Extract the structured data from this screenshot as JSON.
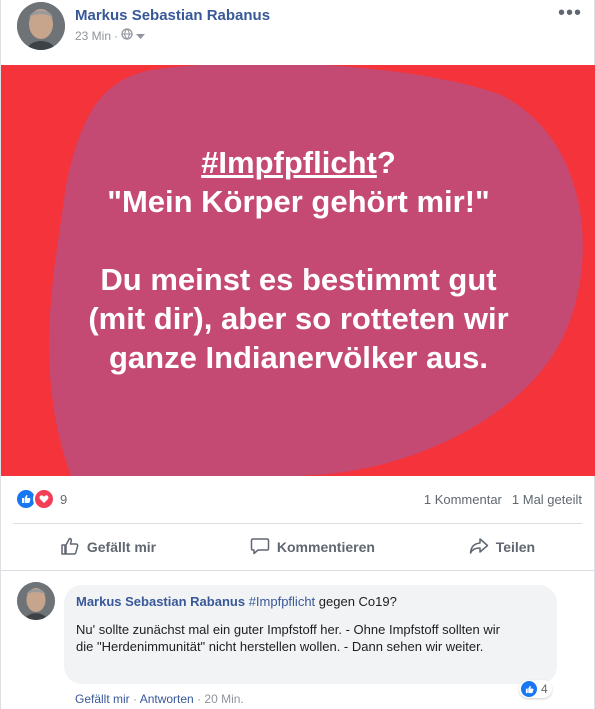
{
  "post": {
    "author": "Markus Sebastian Rabanus",
    "time": "23 Min",
    "separator": "·",
    "visibility_icon": "globe-icon",
    "more_label": "•••",
    "image": {
      "background": "#f4333a",
      "blob_color": "#c04c7a",
      "hashtag": "#Impfpflicht",
      "hashtag_suffix": "?",
      "line2": "\"Mein Körper gehört mir!\"",
      "line3": "Du meinst es bestimmt gut",
      "line4": "(mit dir), aber so rotteten wir",
      "line5": "ganze Indianervölker aus."
    },
    "reactions": {
      "count": "9",
      "types": [
        "like-icon",
        "love-icon"
      ]
    },
    "stats": {
      "comments": "1 Kommentar",
      "shares": "1 Mal geteilt"
    },
    "actions": {
      "like": "Gefällt mir",
      "comment": "Kommentieren",
      "share": "Teilen"
    }
  },
  "comment": {
    "author": "Markus Sebastian Rabanus",
    "tag": "#Impfpflicht",
    "headline_rest": " gegen Co19?",
    "body": "Nu' sollte zunächst mal ein guter Impfstoff her. - Ohne Impfstoff sollten wir die \"Herdenimmunität\" nicht herstellen wollen. - Dann sehen wir weiter.",
    "like_link": "Gefällt mir",
    "reply_link": "Antworten",
    "time": "20 Min.",
    "sep": " · ",
    "reaction_count": "4"
  },
  "colors": {
    "link_blue": "#385898",
    "like_blue": "#1877f2",
    "love_red": "#f33e58"
  }
}
